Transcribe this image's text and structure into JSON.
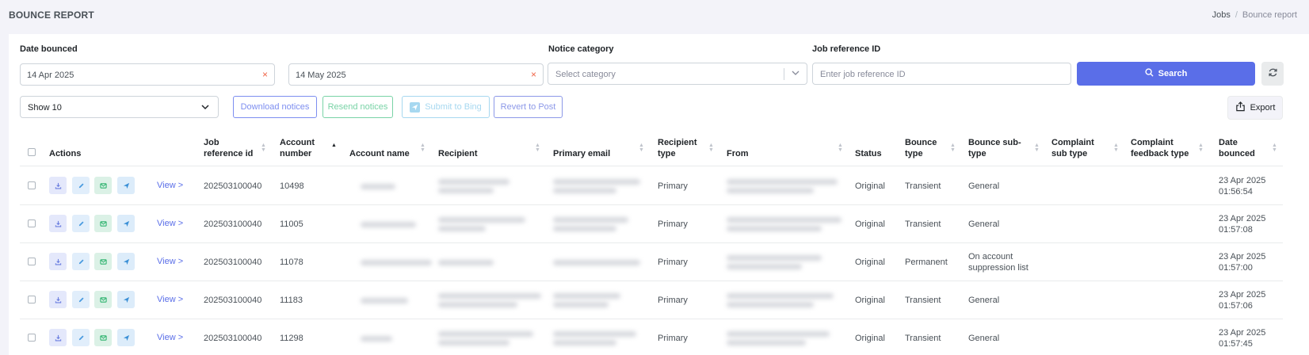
{
  "page": {
    "title": "BOUNCE REPORT"
  },
  "breadcrumb": {
    "jobs": "Jobs",
    "separator": "/",
    "current": "Bounce report"
  },
  "filters": {
    "date_bounced_label": "Date bounced",
    "date_from": "14 Apr 2025",
    "date_to": "14 May 2025",
    "clear_symbol": "×",
    "notice_category_label": "Notice category",
    "notice_category_placeholder": "Select category",
    "job_reference_label": "Job reference ID",
    "job_reference_placeholder": "Enter job reference ID",
    "search_label": "Search"
  },
  "toolbar": {
    "show_value": "Show 10",
    "download_label": "Download notices",
    "resend_label": "Resend notices",
    "submit_label": "Submit to Bing",
    "revert_label": "Revert to Post",
    "export_label": "Export"
  },
  "table": {
    "headers": {
      "actions": "Actions",
      "job_ref_1": "Job",
      "job_ref_2": "reference id",
      "account_number_1": "Account",
      "account_number_2": "number",
      "account_name": "Account name",
      "recipient": "Recipient",
      "primary_email": "Primary email",
      "recipient_type_1": "Recipient",
      "recipient_type_2": "type",
      "from": "From",
      "status": "Status",
      "bounce_type_1": "Bounce",
      "bounce_type_2": "type",
      "bounce_subtype_1": "Bounce sub-",
      "bounce_subtype_2": "type",
      "complaint_subtype_1": "Complaint",
      "complaint_subtype_2": "sub type",
      "complaint_feedback_1": "Complaint",
      "complaint_feedback_2": "feedback type",
      "date_bounced_1": "Date",
      "date_bounced_2": "bounced"
    },
    "view_label": "View >",
    "rows": [
      {
        "job_ref": "202503100040",
        "account_number": "10498",
        "recipient_type": "Primary",
        "status": "Original",
        "bounce_type": "Transient",
        "bounce_subtype_1": "General",
        "bounce_subtype_2": "",
        "date": "23 Apr 2025",
        "time": "01:56:54"
      },
      {
        "job_ref": "202503100040",
        "account_number": "11005",
        "recipient_type": "Primary",
        "status": "Original",
        "bounce_type": "Transient",
        "bounce_subtype_1": "General",
        "bounce_subtype_2": "",
        "date": "23 Apr 2025",
        "time": "01:57:08"
      },
      {
        "job_ref": "202503100040",
        "account_number": "11078",
        "recipient_type": "Primary",
        "status": "Original",
        "bounce_type": "Permanent",
        "bounce_subtype_1": "On account",
        "bounce_subtype_2": "suppression list",
        "date": "23 Apr 2025",
        "time": "01:57:00"
      },
      {
        "job_ref": "202503100040",
        "account_number": "11183",
        "recipient_type": "Primary",
        "status": "Original",
        "bounce_type": "Transient",
        "bounce_subtype_1": "General",
        "bounce_subtype_2": "",
        "date": "23 Apr 2025",
        "time": "01:57:06"
      },
      {
        "job_ref": "202503100040",
        "account_number": "11298",
        "recipient_type": "Primary",
        "status": "Original",
        "bounce_type": "Transient",
        "bounce_subtype_1": "General",
        "bounce_subtype_2": "",
        "date": "23 Apr 2025",
        "time": "01:57:45"
      }
    ]
  },
  "icons": {
    "download": "download-icon",
    "edit": "pencil-icon",
    "email": "envelope-icon",
    "send": "send-icon",
    "search": "search-icon",
    "refresh": "refresh-icon",
    "export": "export-icon",
    "chevron": "chevron-down-icon"
  },
  "colors": {
    "primary": "#5a6ee8",
    "success": "#79d3a6",
    "danger": "#f06548",
    "info": "#a7d8f0"
  }
}
